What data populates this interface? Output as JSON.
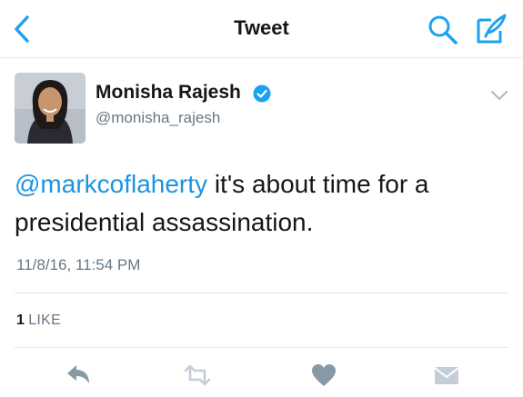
{
  "header": {
    "title": "Tweet"
  },
  "tweet": {
    "author_name": "Monisha Rajesh",
    "handle": "@monisha_rajesh",
    "mention": "@markcoflaherty",
    "text": " it's about time for a presidential assassination.",
    "timestamp": "11/8/16, 11:54 PM"
  },
  "stats": {
    "like_count": "1",
    "like_label": "LIKE"
  },
  "colors": {
    "accent": "#1da1f2",
    "link": "#1b95e0",
    "text": "#14171a",
    "secondary": "#657786",
    "border": "#e1e8ed",
    "action_icon": "#8899a6"
  },
  "icons": {
    "back": "chevron-left-icon",
    "search": "search-icon",
    "compose": "compose-icon",
    "verified": "verified-badge-icon",
    "menu": "chevron-down-icon",
    "reply": "reply-icon",
    "retweet": "retweet-icon",
    "like": "heart-icon",
    "dm": "envelope-icon"
  }
}
